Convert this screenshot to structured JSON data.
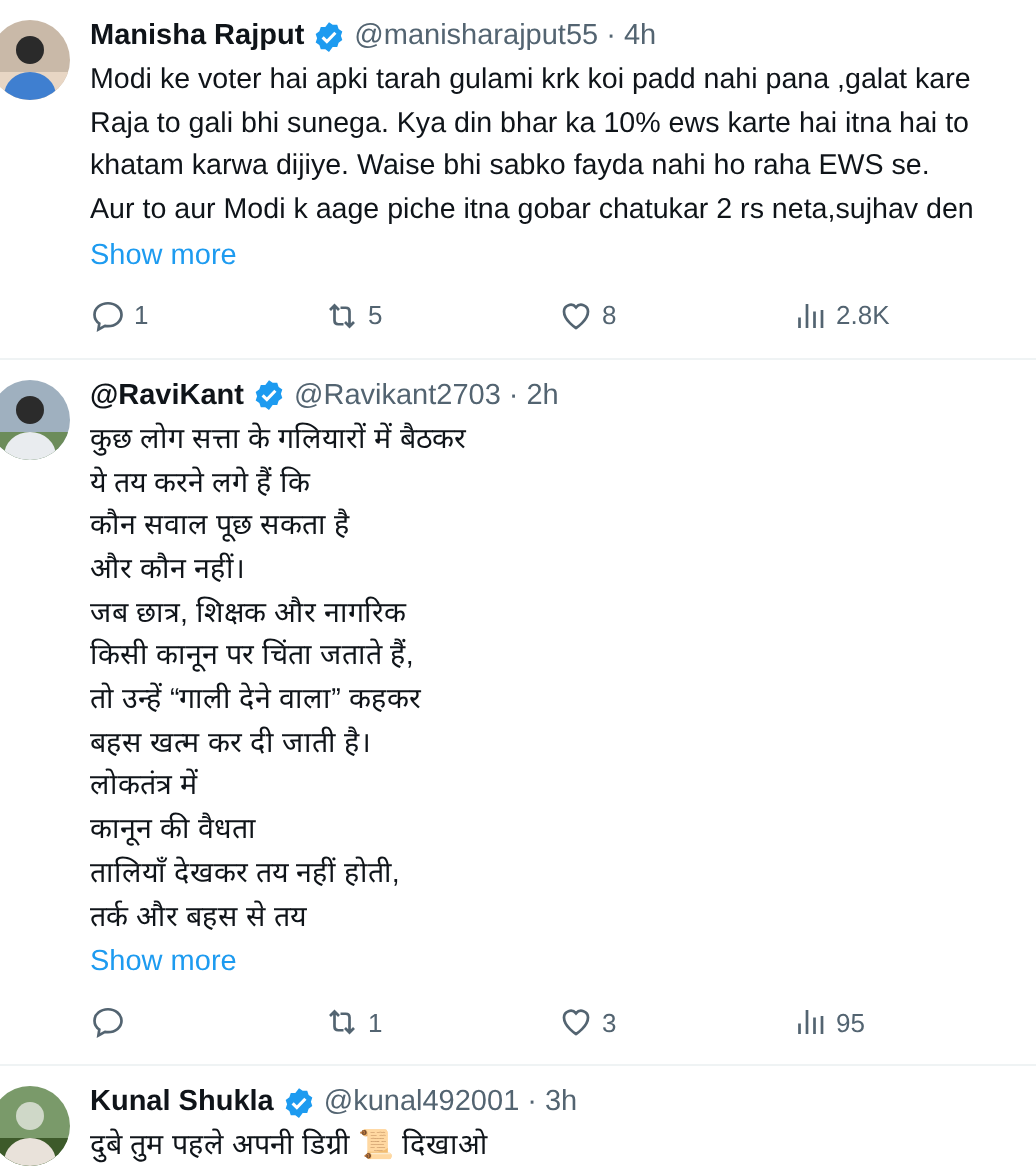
{
  "tweets": [
    {
      "name": "Manisha Rajput",
      "verified": true,
      "handle": "@manisharajput55",
      "time": "· 4h",
      "lines": [
        "Modi ke voter hai apki tarah gulami krk koi padd nahi pana ,galat kare",
        "Raja to gali bhi sunega. Kya din bhar ka 10% ews karte hai itna hai to",
        "khatam karwa dijiye. Waise bhi sabko fayda nahi ho raha EWS se.",
        "Aur to aur Modi k aage piche itna gobar chatukar 2 rs neta,sujhav den"
      ],
      "show_more": "Show more",
      "actions": {
        "replies": "1",
        "reposts": "5",
        "likes": "8",
        "views": "2.8K"
      }
    },
    {
      "name": "@RaviKant",
      "verified": true,
      "handle": "@Ravikant2703",
      "time": "· 2h",
      "lines": [
        "कुछ लोग सत्ता के गलियारों में बैठकर",
        "ये तय करने लगे हैं कि",
        "कौन सवाल पूछ सकता है",
        "और कौन नहीं।",
        "जब छात्र, शिक्षक और नागरिक",
        "किसी कानून पर चिंता जताते हैं,",
        "तो उन्हें “गाली देने वाला” कहकर",
        "बहस खत्म कर दी जाती है।",
        "लोकतंत्र में",
        "कानून की वैधता",
        "तालियाँ देखकर तय नहीं होती,",
        "तर्क और बहस से तय"
      ],
      "show_more": "Show more",
      "actions": {
        "reposts": "1",
        "likes": "3",
        "views": "95"
      }
    },
    {
      "name": "Kunal Shukla",
      "verified": true,
      "handle": "@kunal492001",
      "time": "· 3h",
      "lines": [
        "दुबे तुम पहले अपनी डिग्री 📜 दिखाओ"
      ]
    }
  ]
}
